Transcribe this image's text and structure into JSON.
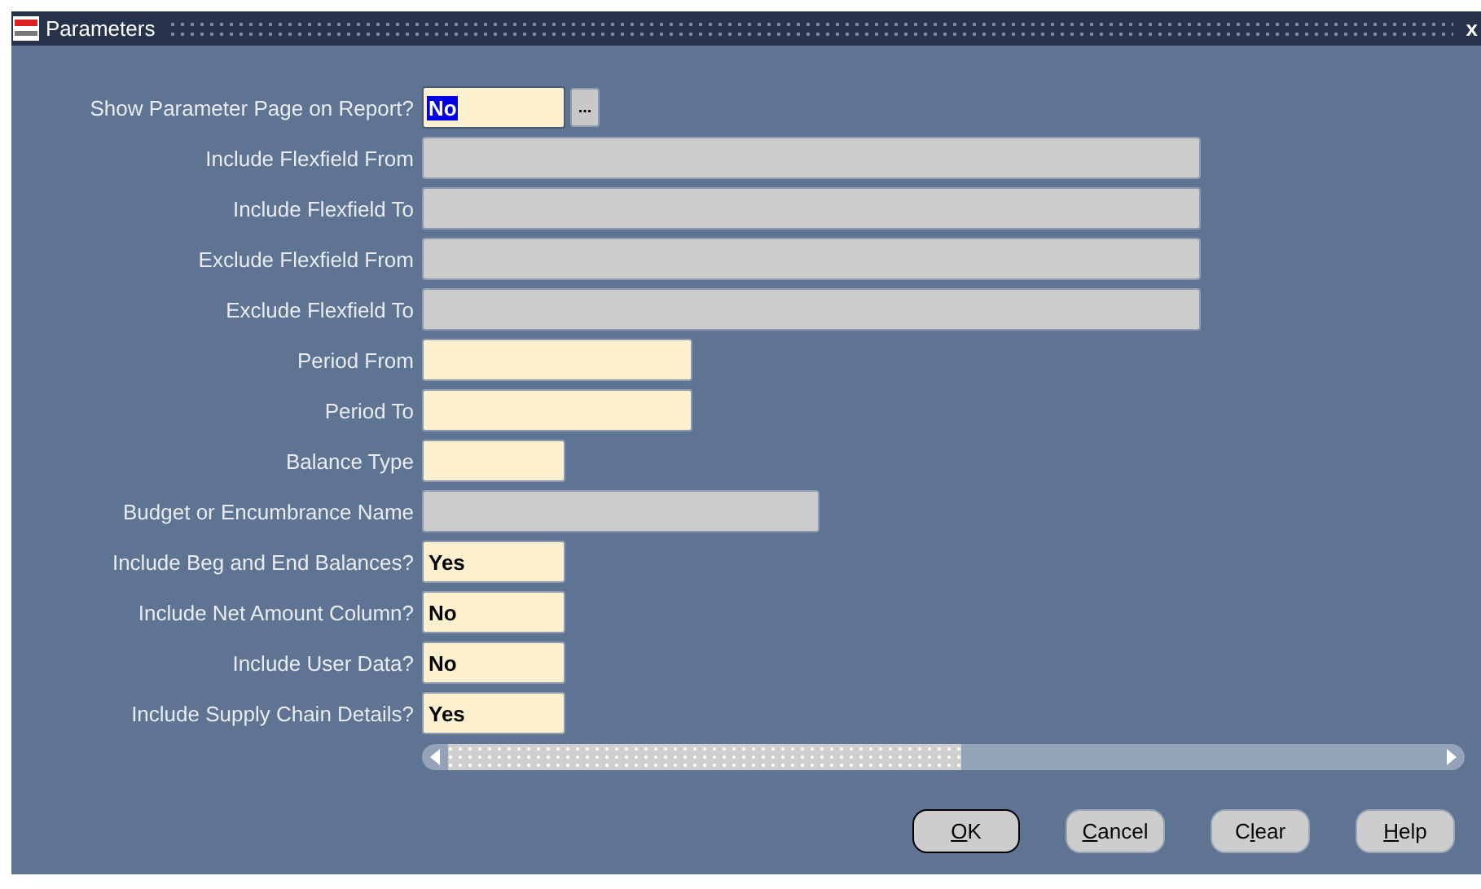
{
  "window": {
    "title": "Parameters",
    "close": "x"
  },
  "fields": [
    {
      "label": "Show Parameter Page on Report?",
      "value": "No",
      "kind": "short",
      "editable": true,
      "selected": true,
      "lov": "..."
    },
    {
      "label": "Include Flexfield From",
      "kind": "wide",
      "editable": false,
      "selected": false
    },
    {
      "label": "Include Flexfield To",
      "kind": "wide",
      "editable": false,
      "selected": false
    },
    {
      "label": "Exclude Flexfield From",
      "kind": "wide",
      "editable": false,
      "selected": false
    },
    {
      "label": "Exclude Flexfield To",
      "kind": "wide",
      "editable": false,
      "selected": false
    },
    {
      "label": "Period From",
      "kind": "medium",
      "editable": true,
      "selected": false
    },
    {
      "label": "Period To",
      "kind": "medium",
      "editable": true,
      "selected": false
    },
    {
      "label": "Balance Type",
      "kind": "short",
      "editable": true,
      "selected": false
    },
    {
      "label": "Budget or Encumbrance Name",
      "kind": "long",
      "editable": false,
      "selected": false
    },
    {
      "label": "Include Beg and End Balances?",
      "value": "Yes",
      "kind": "short",
      "editable": true,
      "selected": false
    },
    {
      "label": "Include Net Amount Column?",
      "value": "No",
      "kind": "short",
      "editable": true,
      "selected": false
    },
    {
      "label": "Include User Data?",
      "value": "No",
      "kind": "short",
      "editable": true,
      "selected": false
    },
    {
      "label": "Include Supply Chain Details?",
      "value": "Yes",
      "kind": "short",
      "editable": true,
      "selected": false
    }
  ],
  "buttons": [
    {
      "key": "O",
      "after": "K",
      "default": true
    },
    {
      "key": "C",
      "after": "ancel",
      "default": false
    },
    {
      "before": "C",
      "key": "l",
      "after": "ear",
      "default": false
    },
    {
      "key": "H",
      "after": "elp",
      "default": false
    }
  ]
}
